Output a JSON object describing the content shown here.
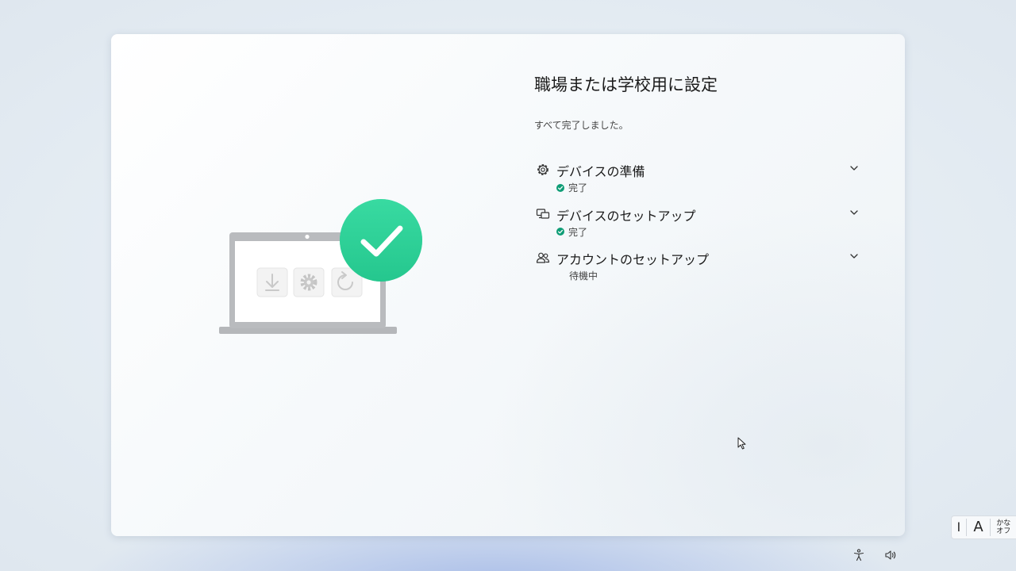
{
  "setup": {
    "title": "職場または学校用に設定",
    "subtitle": "すべて完了しました。",
    "steps": [
      {
        "label": "デバイスの準備",
        "status": "完了",
        "state": "done",
        "icon": "gear-icon"
      },
      {
        "label": "デバイスのセットアップ",
        "status": "完了",
        "state": "done",
        "icon": "devices-icon"
      },
      {
        "label": "アカウントのセットアップ",
        "status": "待機中",
        "state": "pending",
        "icon": "people-icon"
      }
    ]
  },
  "ime": {
    "cursor": "I",
    "mode": "A",
    "kana_line1": "かな",
    "kana_line2": "オフ"
  },
  "colors": {
    "accent_green": "#0f9d76",
    "check_badge": "#2ed39a",
    "panel_bg": "#f6f9fb"
  },
  "system_icons": [
    "accessibility-icon",
    "volume-icon"
  ]
}
